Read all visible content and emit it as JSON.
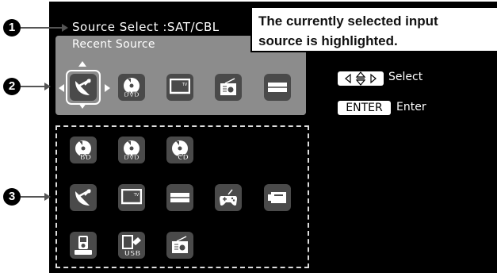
{
  "header": {
    "source_select": "Source Select  :SAT/CBL"
  },
  "callout": {
    "line1": "The currently selected input",
    "line2": "source is highlighted."
  },
  "recent": {
    "label": "Recent Source",
    "items": [
      {
        "icon": "satellite-icon",
        "selected": true
      },
      {
        "icon": "dvd-icon",
        "label": "DVD"
      },
      {
        "icon": "tv-icon",
        "label": "TV"
      },
      {
        "icon": "radio-icon"
      },
      {
        "icon": "player-icon"
      }
    ]
  },
  "all_sources": {
    "row1": [
      {
        "icon": "bluray-icon",
        "label": "BD"
      },
      {
        "icon": "dvd-icon",
        "label": "DVD"
      },
      {
        "icon": "cd-icon",
        "label": "CD"
      }
    ],
    "row2": [
      {
        "icon": "satellite-icon"
      },
      {
        "icon": "tv-icon",
        "label": "TV"
      },
      {
        "icon": "player-icon"
      },
      {
        "icon": "game-icon"
      },
      {
        "icon": "camera-icon"
      }
    ],
    "row3": [
      {
        "icon": "ipod-dock-icon"
      },
      {
        "icon": "usb-icon",
        "label": "USB"
      },
      {
        "icon": "radio-icon"
      }
    ]
  },
  "hints": {
    "select_label": "Select",
    "enter_key": "ENTER",
    "enter_label": "Enter"
  },
  "markers": {
    "m1": "1",
    "m2": "2",
    "m3": "3"
  },
  "colors": {
    "screen_bg": "#000000",
    "panel_bg": "#8c8c8c",
    "icon_bg": "#4a4a4a",
    "foreground": "#ffffff"
  }
}
